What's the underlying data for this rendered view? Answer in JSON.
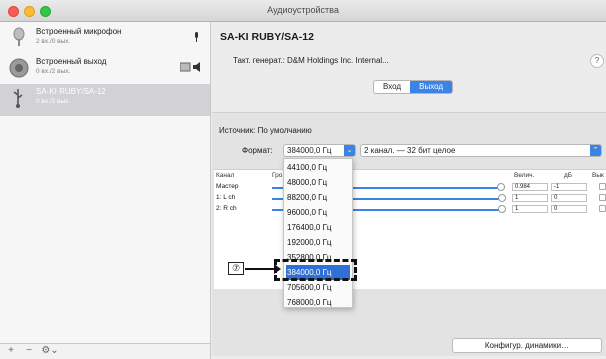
{
  "window": {
    "title": "Аудиоустройства"
  },
  "sidebar": {
    "devices": [
      {
        "name": "Встроенный микрофон",
        "sub": "2 вх./0 вых.",
        "icon": "microphone-icon",
        "badge": "mic-badge-icon"
      },
      {
        "name": "Встроенный выход",
        "sub": "0 вх./2 вых.",
        "icon": "speaker-icon",
        "badge": "speaker-badge-icon"
      },
      {
        "name": "SA-KI RUBY/SA-12",
        "sub": "0 вх./2 вых.",
        "icon": "usb-icon"
      }
    ],
    "add_label": "+",
    "remove_label": "−",
    "gear_label": "⚙⌄"
  },
  "main": {
    "device_title": "SA-KI RUBY/SA-12",
    "clock_label": "Такт. генерат.:",
    "clock_value": "D&M Holdings Inc. Internal...",
    "help_label": "?",
    "tabs": [
      "Вход",
      "Выход"
    ],
    "active_tab": "Выход",
    "source_label": "Источник:",
    "source_value": "По умолчанию",
    "format_label": "Формат:",
    "format_value": "384000,0 Гц",
    "channel_format": "2 канал. — 32 бит целое",
    "table": {
      "headers": [
        "Канал",
        "Гро",
        "Велич.",
        "дБ",
        "Вык"
      ],
      "rows": [
        {
          "name": "Мастер",
          "value": "0.984",
          "db": "-1",
          "level": 0.98
        },
        {
          "name": "1: L ch",
          "value": "1",
          "db": "0",
          "level": 1.0
        },
        {
          "name": "2: R ch",
          "value": "1",
          "db": "0",
          "level": 1.0
        }
      ]
    },
    "configure_label": "Конфигур. динамики…"
  },
  "format_menu": {
    "items": [
      "44100,0 Гц",
      "48000,0 Гц",
      "88200,0 Гц",
      "96000,0 Гц",
      "176400,0 Гц",
      "192000,0 Гц",
      "352800,0 Гц",
      "384000,0 Гц",
      "705600,0 Гц",
      "768000,0 Гц"
    ],
    "selected_index": 7
  },
  "callout": {
    "label": "⑦"
  },
  "colors": {
    "accent": "#3b83e5",
    "selected": "#2f6fd6"
  }
}
